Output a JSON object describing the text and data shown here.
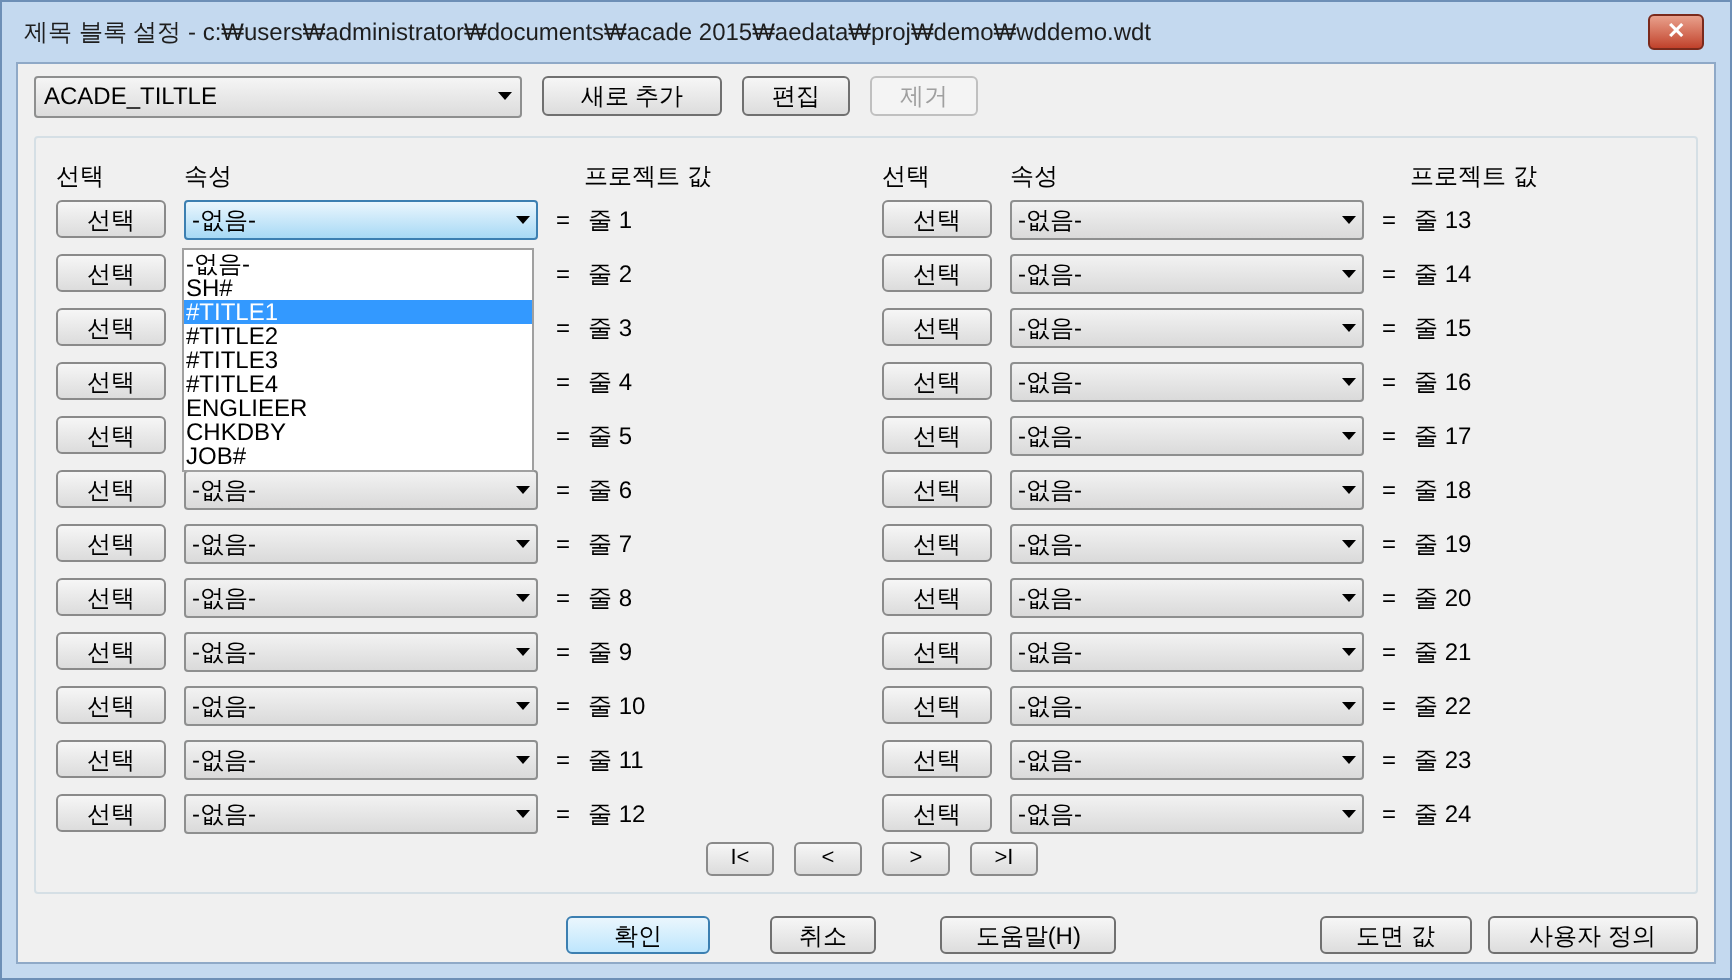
{
  "window": {
    "title": "제목 블록 설정 - c:₩users₩administrator₩documents₩acade 2015₩aedata₩proj₩demo₩wddemo.wdt",
    "close": "✕"
  },
  "toolbar": {
    "block_combo": "ACADE_TILTLE",
    "buttons": [
      {
        "label": "새로 추가",
        "disabled": false
      },
      {
        "label": "편집",
        "disabled": false
      },
      {
        "label": "제거",
        "disabled": true
      }
    ]
  },
  "headers": [
    {
      "select": "선택",
      "attribute": "속성",
      "project_value": "프로젝트 값"
    },
    {
      "select": "선택",
      "attribute": "속성",
      "project_value": "프로젝트 값"
    }
  ],
  "columns": [
    [
      {
        "button": "선택",
        "value": "-없음-",
        "focused": true,
        "equals": "=",
        "line": "줄 1"
      },
      {
        "button": "선택",
        "equals": "=",
        "line": "줄 2"
      },
      {
        "button": "선택",
        "equals": "=",
        "line": "줄 3"
      },
      {
        "button": "선택",
        "equals": "=",
        "line": "줄 4"
      },
      {
        "button": "선택",
        "equals": "=",
        "line": "줄 5"
      },
      {
        "button": "선택",
        "value": "-없음-",
        "focused": false,
        "equals": "=",
        "line": "줄 6"
      },
      {
        "button": "선택",
        "value": "-없음-",
        "focused": false,
        "equals": "=",
        "line": "줄 7"
      },
      {
        "button": "선택",
        "value": "-없음-",
        "focused": false,
        "equals": "=",
        "line": "줄 8"
      },
      {
        "button": "선택",
        "value": "-없음-",
        "focused": false,
        "equals": "=",
        "line": "줄 9"
      },
      {
        "button": "선택",
        "value": "-없음-",
        "focused": false,
        "equals": "=",
        "line": "줄 10"
      },
      {
        "button": "선택",
        "value": "-없음-",
        "focused": false,
        "equals": "=",
        "line": "줄 11"
      },
      {
        "button": "선택",
        "value": "-없음-",
        "focused": false,
        "equals": "=",
        "line": "줄 12"
      }
    ],
    [
      {
        "button": "선택",
        "value": "-없음-",
        "focused": false,
        "equals": "=",
        "line": "줄 13"
      },
      {
        "button": "선택",
        "value": "-없음-",
        "focused": false,
        "equals": "=",
        "line": "줄 14"
      },
      {
        "button": "선택",
        "value": "-없음-",
        "focused": false,
        "equals": "=",
        "line": "줄 15"
      },
      {
        "button": "선택",
        "value": "-없음-",
        "focused": false,
        "equals": "=",
        "line": "줄 16"
      },
      {
        "button": "선택",
        "value": "-없음-",
        "focused": false,
        "equals": "=",
        "line": "줄 17"
      },
      {
        "button": "선택",
        "value": "-없음-",
        "focused": false,
        "equals": "=",
        "line": "줄 18"
      },
      {
        "button": "선택",
        "value": "-없음-",
        "focused": false,
        "equals": "=",
        "line": "줄 19"
      },
      {
        "button": "선택",
        "value": "-없음-",
        "focused": false,
        "equals": "=",
        "line": "줄 20"
      },
      {
        "button": "선택",
        "value": "-없음-",
        "focused": false,
        "equals": "=",
        "line": "줄 21"
      },
      {
        "button": "선택",
        "value": "-없음-",
        "focused": false,
        "equals": "=",
        "line": "줄 22"
      },
      {
        "button": "선택",
        "value": "-없음-",
        "focused": false,
        "equals": "=",
        "line": "줄 23"
      },
      {
        "button": "선택",
        "value": "-없음-",
        "focused": false,
        "equals": "=",
        "line": "줄 24"
      }
    ]
  ],
  "dropdown_list": [
    {
      "label": "-없음-",
      "selected": false
    },
    {
      "label": "SH#",
      "selected": false
    },
    {
      "label": "#TITLE1",
      "selected": true
    },
    {
      "label": "#TITLE2",
      "selected": false
    },
    {
      "label": "#TITLE3",
      "selected": false
    },
    {
      "label": "#TITLE4",
      "selected": false
    },
    {
      "label": "ENGLIEER",
      "selected": false
    },
    {
      "label": "CHKDBY",
      "selected": false
    },
    {
      "label": "JOB#",
      "selected": false
    }
  ],
  "pager": [
    "I<",
    "<",
    ">",
    ">I"
  ],
  "footer": [
    {
      "label": "확인",
      "default": true
    },
    {
      "label": "취소",
      "default": false
    },
    {
      "label": "도움말(H)",
      "default": false
    },
    {
      "label": "도면 값",
      "default": false
    },
    {
      "label": "사용자 정의",
      "default": false
    }
  ]
}
